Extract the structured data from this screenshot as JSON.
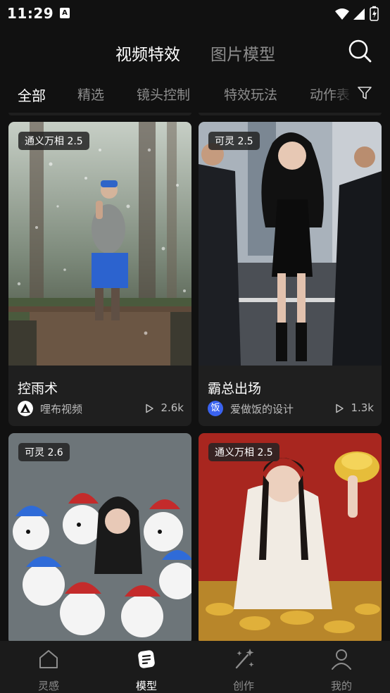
{
  "status_bar": {
    "time": "11:29",
    "app_icon_letter": "A"
  },
  "header": {
    "tabs": [
      {
        "label": "视频特效",
        "active": true
      },
      {
        "label": "图片模型",
        "active": false
      }
    ],
    "search_icon": "search-icon"
  },
  "categories": {
    "items": [
      "全部",
      "精选",
      "镜头控制",
      "特效玩法",
      "动作表"
    ],
    "active_index": 0,
    "filter_icon": "filter-icon"
  },
  "cards": [
    {
      "badge": "通义万相 2.5",
      "title": "控雨术",
      "author": "哩布视频",
      "plays": "2.6k",
      "thumb_theme": "rain-forest"
    },
    {
      "badge": "可灵 2.5",
      "title": "霸总出场",
      "author": "爱做饭的设计",
      "author_avatar_text": "饭",
      "plays": "1.3k",
      "thumb_theme": "city-street"
    },
    {
      "badge": "可灵 2.6",
      "thumb_theme": "snowmen"
    },
    {
      "badge": "通义万相 2.5",
      "thumb_theme": "gold-ingots"
    }
  ],
  "bottom_nav": {
    "items": [
      {
        "label": "灵感",
        "icon": "home-icon",
        "active": false
      },
      {
        "label": "模型",
        "icon": "model-icon",
        "active": true
      },
      {
        "label": "创作",
        "icon": "magic-wand-icon",
        "active": false
      },
      {
        "label": "我的",
        "icon": "profile-icon",
        "active": false
      }
    ]
  },
  "colors": {
    "background": "#111111",
    "card": "#1f1f1f",
    "inactive_text": "#8d8d8d",
    "accent_blue": "#3a63f0"
  }
}
